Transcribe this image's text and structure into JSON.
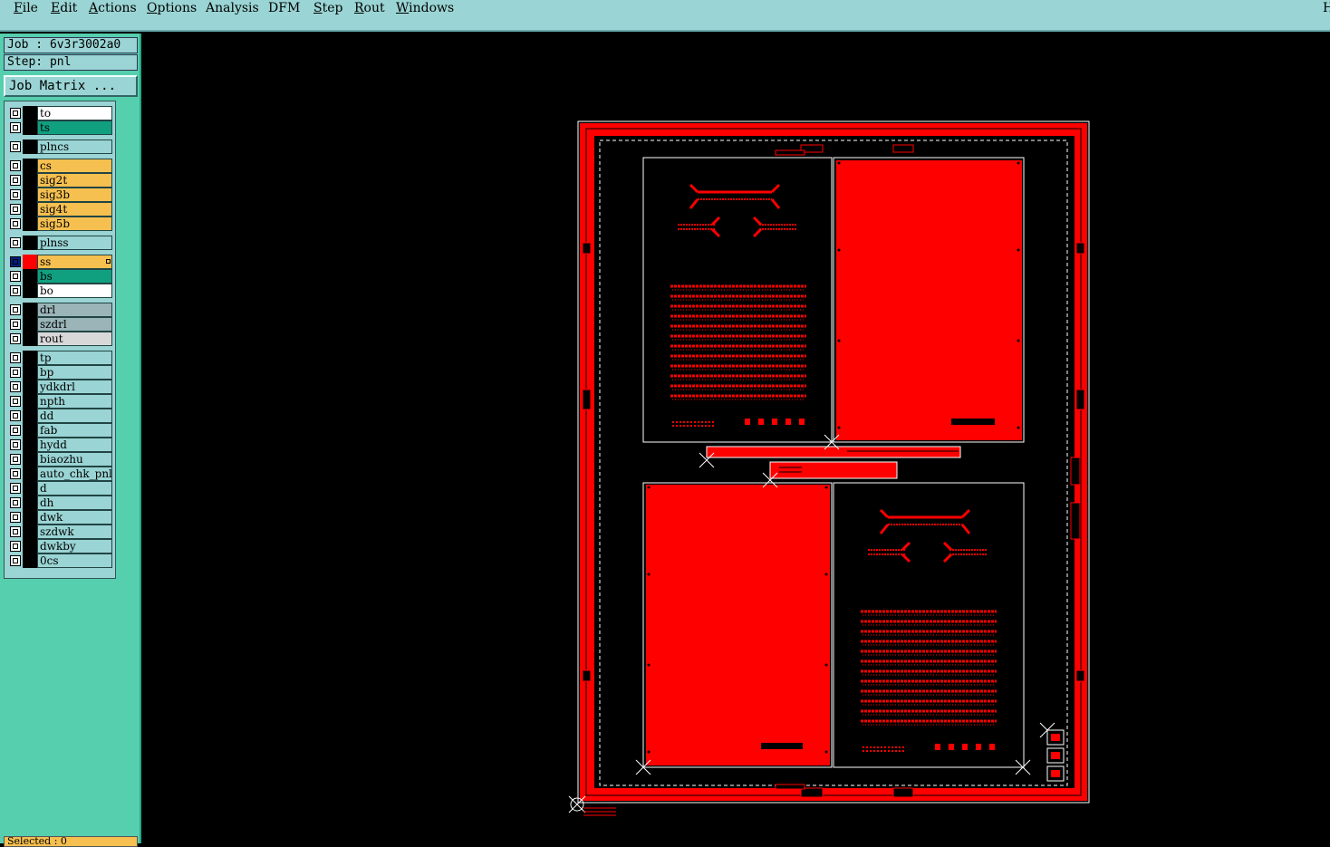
{
  "menu": [
    "File",
    "Edit",
    "Actions",
    "Options",
    "Analysis",
    "DFM",
    "Step",
    "Rout",
    "Windows"
  ],
  "menu_underline": [
    "F",
    "E",
    "A",
    "O",
    "",
    "",
    "S",
    "R",
    "W"
  ],
  "menu_right_label": "H",
  "job_label": "Job : 6v3r3002a0",
  "step_label": "Step: pnl",
  "job_matrix_button": "Job Matrix ...",
  "layers": [
    {
      "name": "to",
      "color": "#ffffff",
      "group": 0
    },
    {
      "name": "ts",
      "color": "#10a080",
      "group": 0
    },
    {
      "name": "plncs",
      "color": "#9ad4d4",
      "group": 1
    },
    {
      "name": "cs",
      "color": "#f5c050",
      "group": 2
    },
    {
      "name": "sig2t",
      "color": "#f5c050",
      "group": 2
    },
    {
      "name": "sig3b",
      "color": "#f5c050",
      "group": 2
    },
    {
      "name": "sig4t",
      "color": "#f5c050",
      "group": 2
    },
    {
      "name": "sig5b",
      "color": "#f5c050",
      "group": 2
    },
    {
      "name": "plnss",
      "color": "#9ad4d4",
      "group": 3
    },
    {
      "name": "ss",
      "color": "#f5c050",
      "group": 4,
      "active": true
    },
    {
      "name": "bs",
      "color": "#10a080",
      "group": 4
    },
    {
      "name": "bo",
      "color": "#ffffff",
      "group": 4
    },
    {
      "name": "drl",
      "color": "#9ab4b8",
      "group": 5
    },
    {
      "name": "szdrl",
      "color": "#9ab4b8",
      "group": 5
    },
    {
      "name": "rout",
      "color": "#d8d8d8",
      "group": 5
    },
    {
      "name": "tp",
      "color": "#9ad4d4",
      "group": 6
    },
    {
      "name": "bp",
      "color": "#9ad4d4",
      "group": 6
    },
    {
      "name": "ydkdrl",
      "color": "#9ad4d4",
      "group": 6
    },
    {
      "name": "npth",
      "color": "#9ad4d4",
      "group": 6
    },
    {
      "name": "dd",
      "color": "#9ad4d4",
      "group": 6
    },
    {
      "name": "fab",
      "color": "#9ad4d4",
      "group": 6
    },
    {
      "name": "hydd",
      "color": "#9ad4d4",
      "group": 6
    },
    {
      "name": "biaozhu",
      "color": "#9ad4d4",
      "group": 6
    },
    {
      "name": "auto_chk_pnl",
      "color": "#9ad4d4",
      "group": 6
    },
    {
      "name": "d",
      "color": "#9ad4d4",
      "group": 6
    },
    {
      "name": "dh",
      "color": "#9ad4d4",
      "group": 6
    },
    {
      "name": "dwk",
      "color": "#9ad4d4",
      "group": 6
    },
    {
      "name": "szdwk",
      "color": "#9ad4d4",
      "group": 6
    },
    {
      "name": "dwkby",
      "color": "#9ad4d4",
      "group": 6
    },
    {
      "name": "0cs",
      "color": "#9ad4d4",
      "group": 6
    }
  ],
  "selected_label": "Selected : 0",
  "colors": {
    "graphics_background": "#000000",
    "feature_red": "#ff0000",
    "outline_white": "#ffffff",
    "panel_teal": "#55cfad",
    "menu_cyan": "#9ad4d4"
  }
}
